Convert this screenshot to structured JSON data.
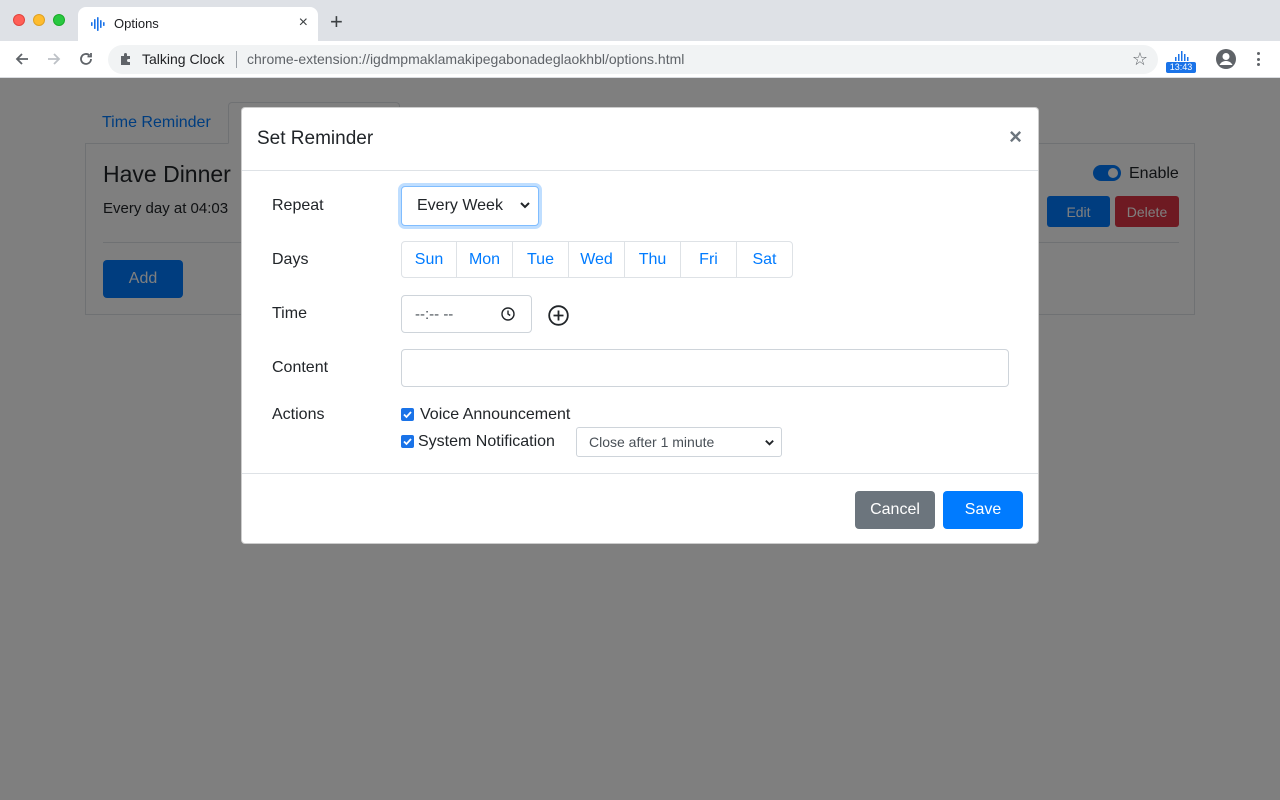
{
  "browser": {
    "tab_title": "Options",
    "new_tab_symbol": "+",
    "tab_close_symbol": "×",
    "omnibox_site": "Talking Clock",
    "omnibox_url": "chrome-extension://igdmpmaklamakipegabonadeglaokhbl/options.html",
    "extension_badge": "13:43",
    "bookmark_star": "☆"
  },
  "page": {
    "tabs": [
      "Time Reminder",
      ""
    ],
    "reminder": {
      "title": "Have Dinner",
      "description": "Every day at 04:03",
      "enable_label": "Enable",
      "enabled": true,
      "edit_label": "Edit",
      "delete_label": "Delete"
    },
    "add_label": "Add"
  },
  "modal": {
    "title": "Set Reminder",
    "close_symbol": "×",
    "repeat_label": "Repeat",
    "repeat_value": "Every Week",
    "days_label": "Days",
    "days": [
      "Sun",
      "Mon",
      "Tue",
      "Wed",
      "Thu",
      "Fri",
      "Sat"
    ],
    "time_label": "Time",
    "time_placeholder": "--:-- --",
    "content_label": "Content",
    "content_value": "",
    "actions_label": "Actions",
    "voice_label": "Voice Announcement",
    "voice_checked": true,
    "notification_label": "System Notification",
    "notification_checked": true,
    "close_after_value": "Close after 1 minute",
    "cancel_label": "Cancel",
    "save_label": "Save"
  },
  "colors": {
    "primary": "#007bff",
    "danger": "#dc3545",
    "secondary": "#6c757d",
    "backdrop": "rgba(0,0,0,0.5)"
  }
}
